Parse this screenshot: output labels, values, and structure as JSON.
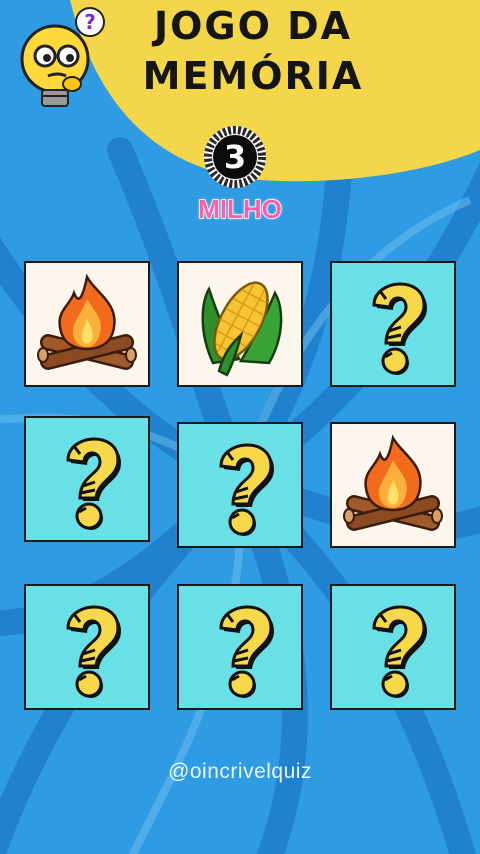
{
  "game": {
    "title_line1": "JOGO DA",
    "title_line2": "MEMÓRIA",
    "timer": "3",
    "target_word": "MILHO",
    "credit": "@oincrivelquiz"
  },
  "colors": {
    "background": "#2e9be3",
    "header": "#f3d64a",
    "card_back": "#68e0e6",
    "card_front": "#fcf6ec",
    "word": "#ff5fa8"
  },
  "board": {
    "rows": 3,
    "cols": 3,
    "cards": [
      {
        "face": "campfire-icon",
        "state": "revealed"
      },
      {
        "face": "corn-icon",
        "state": "revealed"
      },
      {
        "face": "question-mark-icon",
        "state": "hidden"
      },
      {
        "face": "question-mark-icon",
        "state": "hidden"
      },
      {
        "face": "question-mark-icon",
        "state": "hidden"
      },
      {
        "face": "campfire-icon",
        "state": "revealed"
      },
      {
        "face": "question-mark-icon",
        "state": "hidden"
      },
      {
        "face": "question-mark-icon",
        "state": "hidden"
      },
      {
        "face": "question-mark-icon",
        "state": "hidden"
      }
    ]
  }
}
